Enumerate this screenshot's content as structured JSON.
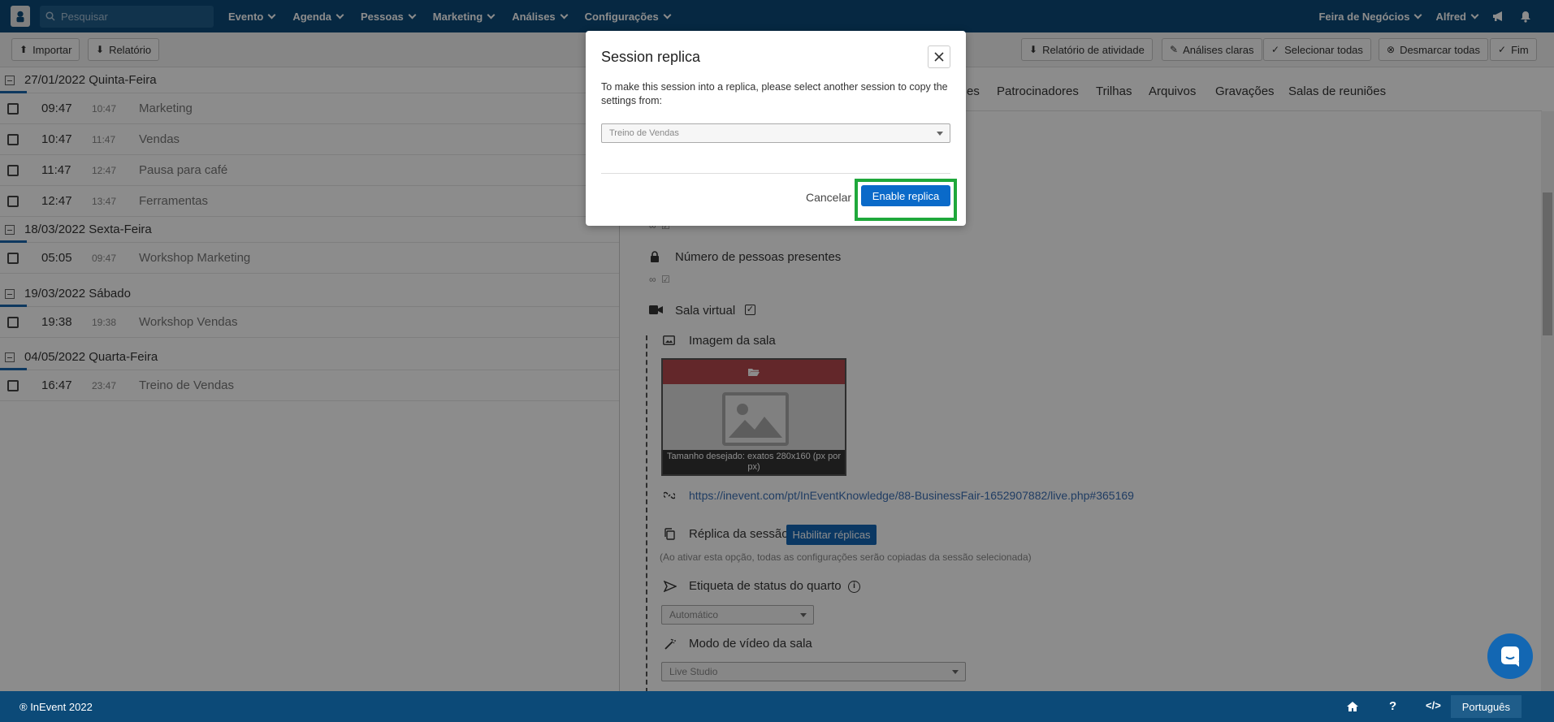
{
  "nav": {
    "search_placeholder": "Pesquisar",
    "menu": [
      "Evento",
      "Agenda",
      "Pessoas",
      "Marketing",
      "Análises",
      "Configurações"
    ],
    "event_name": "Feira de Negócios",
    "user": "Alfred"
  },
  "toolbar": {
    "import": "Importar",
    "report": "Relatório",
    "activity_report": "Relatório de atividade",
    "clear_analytics": "Análises claras",
    "select_all": "Selecionar todas",
    "deselect_all": "Desmarcar todas",
    "end": "Fim"
  },
  "agenda": [
    {
      "date": "27/01/2022  Quinta-Feira",
      "sessions": [
        {
          "start": "09:47",
          "end": "10:47",
          "title": "Marketing"
        },
        {
          "start": "10:47",
          "end": "11:47",
          "title": "Vendas"
        },
        {
          "start": "11:47",
          "end": "12:47",
          "title": "Pausa para café"
        },
        {
          "start": "12:47",
          "end": "13:47",
          "title": "Ferramentas"
        }
      ]
    },
    {
      "date": "18/03/2022  Sexta-Feira",
      "sessions": [
        {
          "start": "05:05",
          "end": "09:47",
          "title": "Workshop Marketing"
        }
      ]
    },
    {
      "date": "19/03/2022  Sábado",
      "sessions": [
        {
          "start": "19:38",
          "end": "19:38",
          "title": "Workshop Vendas"
        }
      ]
    },
    {
      "date": "04/05/2022  Quarta-Feira",
      "sessions": [
        {
          "start": "16:47",
          "end": "23:47",
          "title": "Treino de Vendas"
        }
      ]
    }
  ],
  "detail": {
    "tabs": [
      "es",
      "Patrocinadores",
      "Trilhas",
      "Arquivos",
      "Gravações",
      "Salas de reuniões"
    ],
    "infinity": "∞",
    "attendees_label": "Número de pessoas presentes",
    "virtual_room_label": "Sala virtual",
    "room_image_label": "Imagem da sala",
    "image_caption": "Tamanho desejado: exatos 280x160 (px por px)",
    "live_link": "https://inevent.com/pt/InEventKnowledge/88-BusinessFair-1652907882/live.php#365169",
    "replica_label": "Réplica da sessão",
    "enable_replicas": "Habilitar réplicas",
    "replica_note": "(Ao ativar esta opção, todas as configurações serão copiadas da sessão selecionada)",
    "status_tag_label": "Etiqueta de status do quarto",
    "status_tag_value": "Automático",
    "video_mode_label": "Modo de vídeo da sala",
    "video_mode_value": "Live Studio"
  },
  "modal": {
    "title": "Session replica",
    "description": "To make this session into a replica, please select another session to copy the settings from:",
    "selected_session": "Treino de Vendas",
    "cancel": "Cancelar",
    "enable": "Enable replica"
  },
  "footer": {
    "copyright": "® InEvent 2022",
    "language": "Português"
  },
  "colors": {
    "nav_bg": "#0c4a78",
    "primary_button": "#0a6ac9",
    "highlight": "#1fa83b",
    "image_bar": "#b5484e"
  }
}
